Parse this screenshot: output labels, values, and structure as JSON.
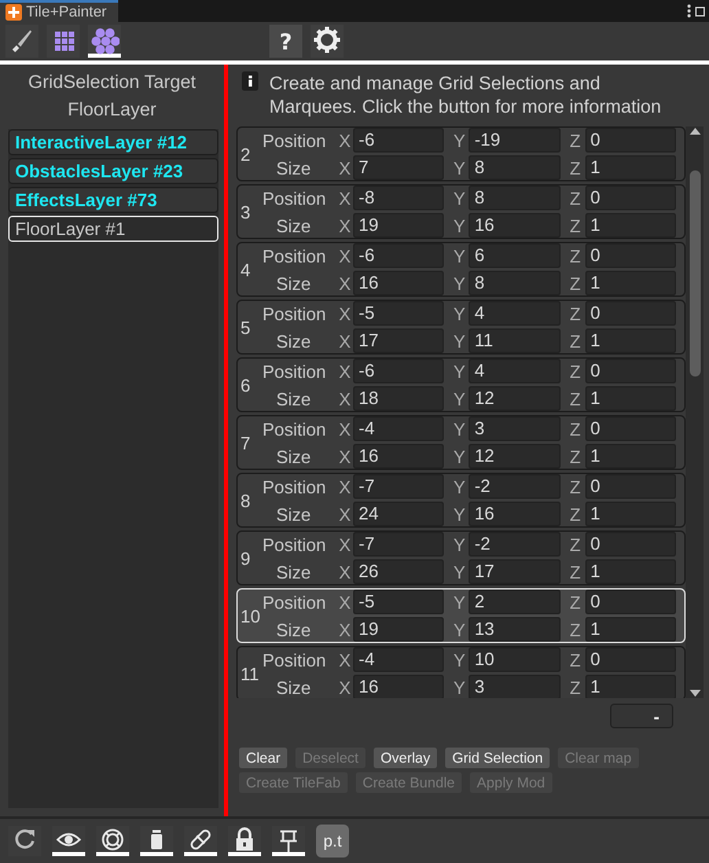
{
  "window": {
    "title": "Tile+Painter"
  },
  "toolbar": {
    "tools": [
      {
        "kind": "brush",
        "selected": false
      },
      {
        "kind": "grid",
        "selected": false
      },
      {
        "kind": "hexes",
        "selected": true
      }
    ],
    "help": "?"
  },
  "target": {
    "heading": "GridSelection Target",
    "layer": "FloorLayer"
  },
  "layers": [
    {
      "label": "InteractiveLayer #12",
      "highlighted": true,
      "selected": false
    },
    {
      "label": "ObstaclesLayer #23",
      "highlighted": true,
      "selected": false
    },
    {
      "label": "EffectsLayer #73",
      "highlighted": true,
      "selected": false
    },
    {
      "label": "FloorLayer #1",
      "highlighted": false,
      "selected": true
    }
  ],
  "info": "Create and manage Grid Selections and Marquees. Click the button for more information",
  "selections": [
    {
      "index": "2",
      "selected": false,
      "position_label": "Position",
      "size_label": "Size",
      "position": [
        {
          "axis": "X",
          "value": "-6"
        },
        {
          "axis": "Y",
          "value": "-19"
        },
        {
          "axis": "Z",
          "value": "0"
        }
      ],
      "size": [
        {
          "axis": "X",
          "value": "7"
        },
        {
          "axis": "Y",
          "value": "8"
        },
        {
          "axis": "Z",
          "value": "1"
        }
      ]
    },
    {
      "index": "3",
      "selected": false,
      "position_label": "Position",
      "size_label": "Size",
      "position": [
        {
          "axis": "X",
          "value": "-8"
        },
        {
          "axis": "Y",
          "value": "8"
        },
        {
          "axis": "Z",
          "value": "0"
        }
      ],
      "size": [
        {
          "axis": "X",
          "value": "19"
        },
        {
          "axis": "Y",
          "value": "16"
        },
        {
          "axis": "Z",
          "value": "1"
        }
      ]
    },
    {
      "index": "4",
      "selected": false,
      "position_label": "Position",
      "size_label": "Size",
      "position": [
        {
          "axis": "X",
          "value": "-6"
        },
        {
          "axis": "Y",
          "value": "6"
        },
        {
          "axis": "Z",
          "value": "0"
        }
      ],
      "size": [
        {
          "axis": "X",
          "value": "16"
        },
        {
          "axis": "Y",
          "value": "8"
        },
        {
          "axis": "Z",
          "value": "1"
        }
      ]
    },
    {
      "index": "5",
      "selected": false,
      "position_label": "Position",
      "size_label": "Size",
      "position": [
        {
          "axis": "X",
          "value": "-5"
        },
        {
          "axis": "Y",
          "value": "4"
        },
        {
          "axis": "Z",
          "value": "0"
        }
      ],
      "size": [
        {
          "axis": "X",
          "value": "17"
        },
        {
          "axis": "Y",
          "value": "11"
        },
        {
          "axis": "Z",
          "value": "1"
        }
      ]
    },
    {
      "index": "6",
      "selected": false,
      "position_label": "Position",
      "size_label": "Size",
      "position": [
        {
          "axis": "X",
          "value": "-6"
        },
        {
          "axis": "Y",
          "value": "4"
        },
        {
          "axis": "Z",
          "value": "0"
        }
      ],
      "size": [
        {
          "axis": "X",
          "value": "18"
        },
        {
          "axis": "Y",
          "value": "12"
        },
        {
          "axis": "Z",
          "value": "1"
        }
      ]
    },
    {
      "index": "7",
      "selected": false,
      "position_label": "Position",
      "size_label": "Size",
      "position": [
        {
          "axis": "X",
          "value": "-4"
        },
        {
          "axis": "Y",
          "value": "3"
        },
        {
          "axis": "Z",
          "value": "0"
        }
      ],
      "size": [
        {
          "axis": "X",
          "value": "16"
        },
        {
          "axis": "Y",
          "value": "12"
        },
        {
          "axis": "Z",
          "value": "1"
        }
      ]
    },
    {
      "index": "8",
      "selected": false,
      "position_label": "Position",
      "size_label": "Size",
      "position": [
        {
          "axis": "X",
          "value": "-7"
        },
        {
          "axis": "Y",
          "value": "-2"
        },
        {
          "axis": "Z",
          "value": "0"
        }
      ],
      "size": [
        {
          "axis": "X",
          "value": "24"
        },
        {
          "axis": "Y",
          "value": "16"
        },
        {
          "axis": "Z",
          "value": "1"
        }
      ]
    },
    {
      "index": "9",
      "selected": false,
      "position_label": "Position",
      "size_label": "Size",
      "position": [
        {
          "axis": "X",
          "value": "-7"
        },
        {
          "axis": "Y",
          "value": "-2"
        },
        {
          "axis": "Z",
          "value": "0"
        }
      ],
      "size": [
        {
          "axis": "X",
          "value": "26"
        },
        {
          "axis": "Y",
          "value": "17"
        },
        {
          "axis": "Z",
          "value": "1"
        }
      ]
    },
    {
      "index": "10",
      "selected": true,
      "position_label": "Position",
      "size_label": "Size",
      "position": [
        {
          "axis": "X",
          "value": "-5"
        },
        {
          "axis": "Y",
          "value": "2"
        },
        {
          "axis": "Z",
          "value": "0"
        }
      ],
      "size": [
        {
          "axis": "X",
          "value": "19"
        },
        {
          "axis": "Y",
          "value": "13"
        },
        {
          "axis": "Z",
          "value": "1"
        }
      ]
    },
    {
      "index": "11",
      "selected": false,
      "position_label": "Position",
      "size_label": "Size",
      "position": [
        {
          "axis": "X",
          "value": "-4"
        },
        {
          "axis": "Y",
          "value": "10"
        },
        {
          "axis": "Z",
          "value": "0"
        }
      ],
      "size": [
        {
          "axis": "X",
          "value": "16"
        },
        {
          "axis": "Y",
          "value": "3"
        },
        {
          "axis": "Z",
          "value": "1"
        }
      ]
    }
  ],
  "remove_button": "-",
  "actions": [
    {
      "label": "Clear",
      "disabled": false
    },
    {
      "label": "Deselect",
      "disabled": true
    },
    {
      "label": "Overlay",
      "disabled": false
    },
    {
      "label": "Grid Selection",
      "disabled": false
    },
    {
      "label": "Clear map",
      "disabled": true
    },
    {
      "label": "Create TileFab",
      "disabled": true
    },
    {
      "label": "Create Bundle",
      "disabled": true
    },
    {
      "label": "Apply Mod",
      "disabled": true
    }
  ],
  "bottom_tools": [
    {
      "kind": "refresh",
      "on": false
    },
    {
      "kind": "eye",
      "on": true
    },
    {
      "kind": "lifering",
      "on": true
    },
    {
      "kind": "bin",
      "on": true
    },
    {
      "kind": "link",
      "on": true
    },
    {
      "kind": "lock",
      "on": true
    },
    {
      "kind": "pin",
      "on": true
    }
  ],
  "pt_button": "p.t"
}
